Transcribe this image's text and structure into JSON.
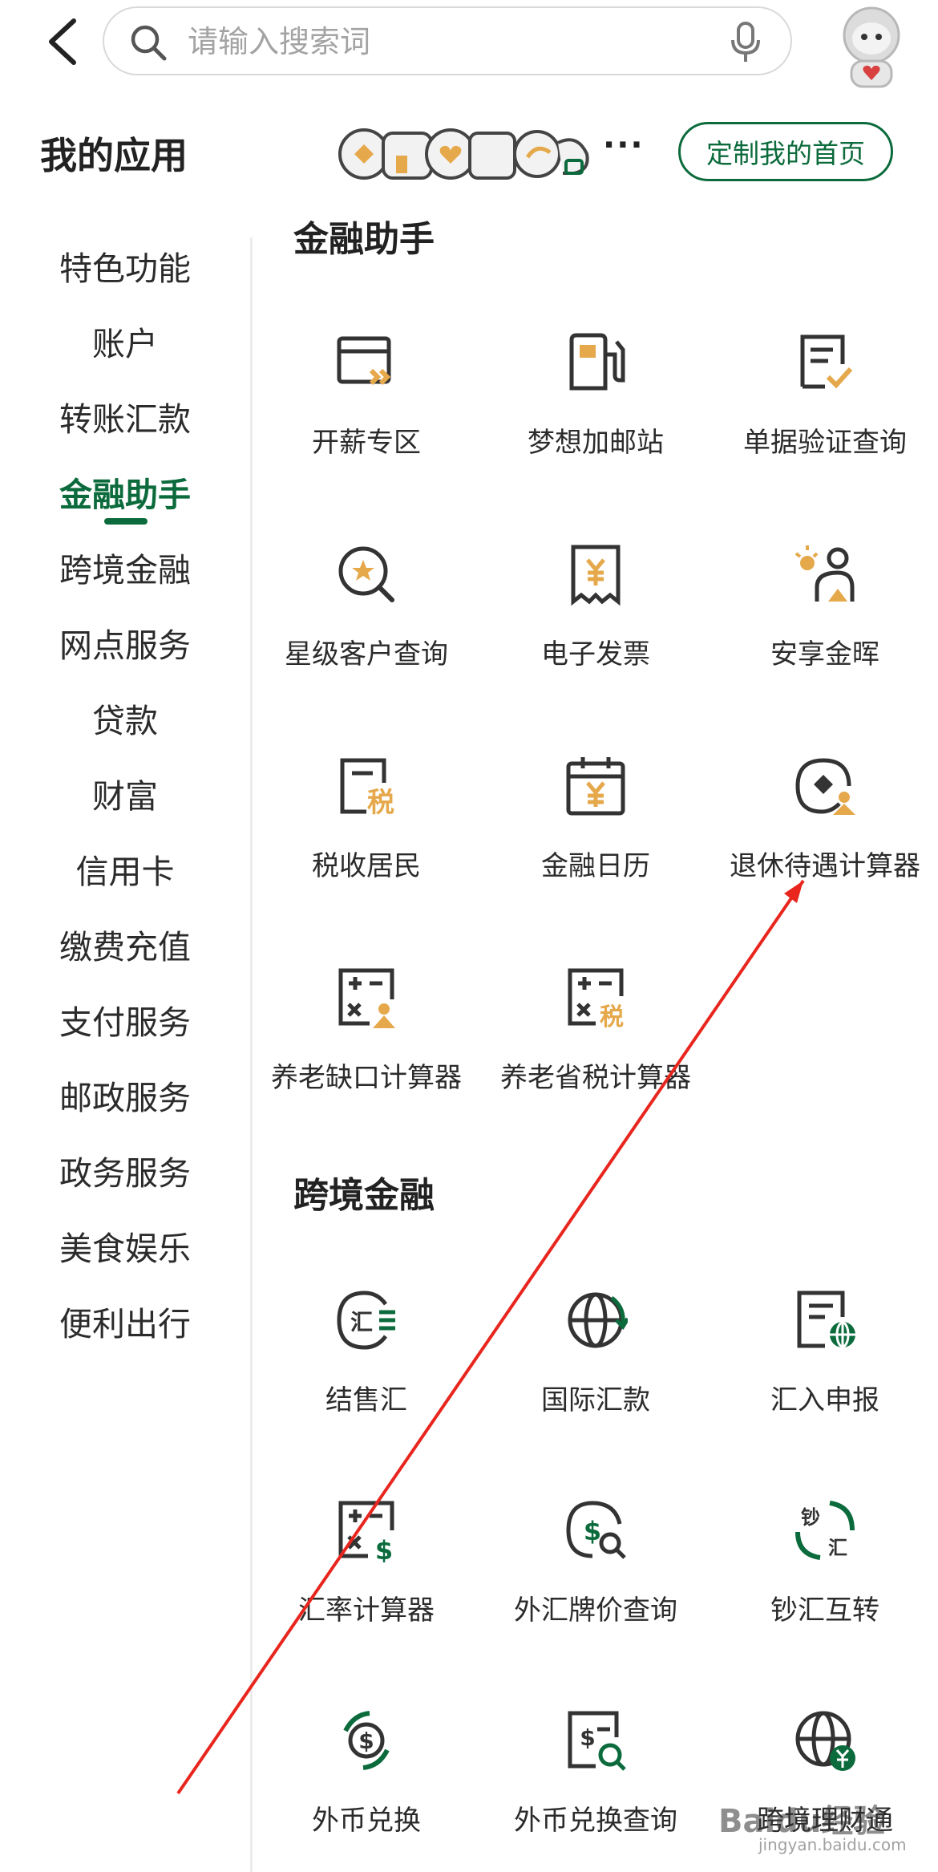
{
  "search": {
    "placeholder": "请输入搜索词"
  },
  "my_apps": {
    "title": "我的应用",
    "more": "···",
    "custom_button": "定制我的首页"
  },
  "sidebar": {
    "items": [
      {
        "label": "特色功能"
      },
      {
        "label": "账户"
      },
      {
        "label": "转账汇款"
      },
      {
        "label": "金融助手",
        "active": true
      },
      {
        "label": "跨境金融"
      },
      {
        "label": "网点服务"
      },
      {
        "label": "贷款"
      },
      {
        "label": "财富"
      },
      {
        "label": "信用卡"
      },
      {
        "label": "缴费充值"
      },
      {
        "label": "支付服务"
      },
      {
        "label": "邮政服务"
      },
      {
        "label": "政务服务"
      },
      {
        "label": "美食娱乐"
      },
      {
        "label": "便利出行"
      }
    ]
  },
  "sections": [
    {
      "title": "金融助手",
      "tiles": [
        {
          "label": "开薪专区",
          "icon": "salary-card-icon"
        },
        {
          "label": "梦想加邮站",
          "icon": "fuel-station-icon"
        },
        {
          "label": "单据验证查询",
          "icon": "document-check-icon"
        },
        {
          "label": "星级客户查询",
          "icon": "star-search-icon"
        },
        {
          "label": "电子发票",
          "icon": "e-invoice-icon"
        },
        {
          "label": "安享金晖",
          "icon": "senior-care-icon"
        },
        {
          "label": "税收居民",
          "icon": "tax-resident-icon"
        },
        {
          "label": "金融日历",
          "icon": "finance-calendar-icon"
        },
        {
          "label": "退休待遇计算器",
          "icon": "retirement-calculator-icon"
        },
        {
          "label": "养老缺口计算器",
          "icon": "pension-gap-calculator-icon"
        },
        {
          "label": "养老省税计算器",
          "icon": "pension-tax-calculator-icon"
        }
      ]
    },
    {
      "title": "跨境金融",
      "tiles": [
        {
          "label": "结售汇",
          "icon": "exchange-settlement-icon"
        },
        {
          "label": "国际汇款",
          "icon": "globe-transfer-icon"
        },
        {
          "label": "汇入申报",
          "icon": "inward-declaration-icon"
        },
        {
          "label": "汇率计算器",
          "icon": "rate-calculator-icon"
        },
        {
          "label": "外汇牌价查询",
          "icon": "fx-rate-search-icon"
        },
        {
          "label": "钞汇互转",
          "icon": "cash-remit-convert-icon"
        },
        {
          "label": "外币兑换",
          "icon": "currency-exchange-icon"
        },
        {
          "label": "外币兑换查询",
          "icon": "currency-exchange-search-icon"
        },
        {
          "label": "跨境理财通",
          "icon": "cross-border-wealth-icon"
        }
      ]
    }
  ],
  "colors": {
    "brand_green": "#0c6b3c",
    "accent_gold": "#e5a84b",
    "icon_dark": "#333333",
    "annotation_red": "#e8261e"
  },
  "watermark": {
    "text": "Baidu经验",
    "sub": "jingyan.baidu.com"
  }
}
